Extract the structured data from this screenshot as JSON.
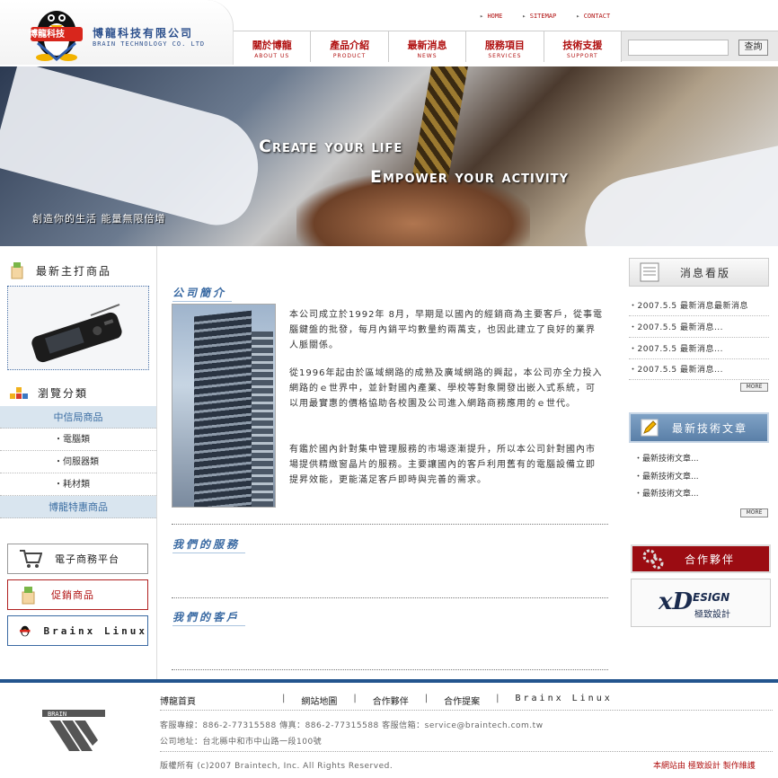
{
  "header": {
    "logo_text": "博龍科技",
    "brand_cn": "博龍科技有限公司",
    "brand_en": "BRAIN TECHNOLOGY CO. LTD",
    "toplinks": [
      "HOME",
      "SITEMAP",
      "CONTACT"
    ],
    "nav": [
      {
        "cn": "關於博龍",
        "en": "ABOUT US"
      },
      {
        "cn": "產品介紹",
        "en": "PRODUCT"
      },
      {
        "cn": "最新消息",
        "en": "NEWS"
      },
      {
        "cn": "服務項目",
        "en": "SERVICES"
      },
      {
        "cn": "技術支援",
        "en": "SUPPORT"
      }
    ],
    "search_button": "查詢"
  },
  "banner": {
    "line1": "Create your life",
    "line2": "Empower your activity",
    "sub": "創造你的生活 能量無限倍增"
  },
  "left": {
    "featured_title": "最新主打商品",
    "browse_title": "瀏覽分類",
    "categories": [
      {
        "label": "中信局商品",
        "type": "main"
      },
      {
        "label": "・電腦類",
        "type": "sub"
      },
      {
        "label": "・伺服器類",
        "type": "sub"
      },
      {
        "label": "・耗材類",
        "type": "sub"
      },
      {
        "label": "博龍特惠商品",
        "type": "main"
      }
    ],
    "buttons": [
      "電子商務平台",
      "促銷商品",
      "Brainx Linux"
    ]
  },
  "main": {
    "intro_title": "公司簡介",
    "paragraphs": [
      "本公司成立於1992年 8月，早期是以國內的經銷商為主要客戶，從事電腦鍵盤的批發，每月內銷平均數量約兩萬支，也因此建立了良好的業界人脈關係。",
      "從1996年起由於區域網路的成熟及廣域網路的興起，本公司亦全力投入網路的ｅ世界中，並針對國內產業、學校等對象開發出嵌入式系統，可以用最實惠的價格協助各校園及公司進入網路商務應用的ｅ世代。",
      "有鑑於國內針對集中管理服務的市場逐漸提升，所以本公司針對國內市場提供精緻窗晶片的服務。主要讓國內的客戶利用舊有的電腦設備立即提昇效能，更能滿足客戶即時與完善的需求。"
    ],
    "services_title": "我們的服務",
    "clients_title": "我們的客戶"
  },
  "right": {
    "news_title": "消息看版",
    "news": [
      "・2007.5.5 最新消息最新消息",
      "・2007.5.5 最新消息...",
      "・2007.5.5 最新消息...",
      "・2007.5.5 最新消息..."
    ],
    "more_label": "MORE",
    "tech_title": "最新技術文章",
    "tech_items": [
      "・最新技術文章...",
      "・最新技術文章...",
      "・最新技術文章..."
    ],
    "partner_title": "合作夥伴",
    "partner_logo_big": "xD",
    "partner_logo_esign": "ESIGN",
    "partner_logo_cn": "極致設計"
  },
  "footer": {
    "nav": [
      "博龍首頁",
      "網站地圖",
      "合作夥伴",
      "合作提案",
      "Brainx Linux"
    ],
    "contact": "客服專線：886-2-77315588    傳真：886-2-77315588    客服信箱：service@braintech.com.tw",
    "address": "公司地址：台北縣中和市中山路一段100號",
    "copyright": "版權所有 (c)2007 Braintech, Inc. All Rights Reserved.",
    "credit": "本網站由 極致設計 製作維護",
    "logo_text": "BRAIN"
  },
  "colors": {
    "accent_red": "#b01010",
    "accent_blue": "#23558e",
    "light_blue": "#d9e5ef"
  }
}
